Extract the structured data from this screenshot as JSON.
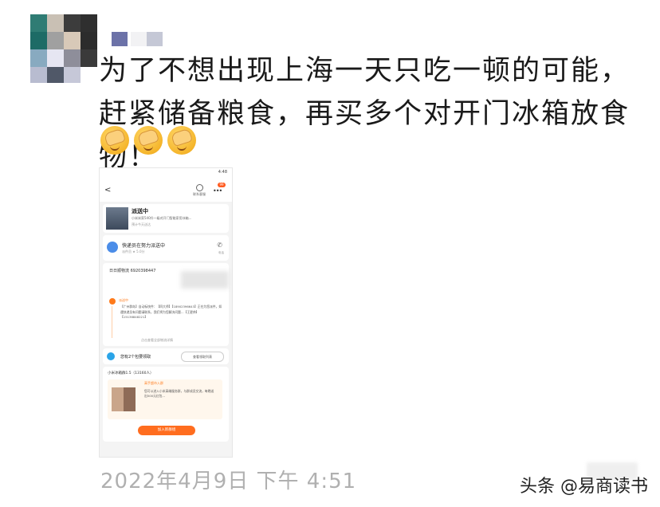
{
  "post": {
    "text": "为了不想出现上海一天只吃一顿的可能，赶紧储备粮食，再买多个对开门冰箱放食物！",
    "emojis": [
      "facepalm-icon",
      "facepalm-icon",
      "facepalm-icon"
    ],
    "timestamp": "2022年4月9日 下午 4:51"
  },
  "embedded_screenshot": {
    "status_time": "4:48",
    "nav": {
      "back": "<",
      "service_label": "联系客服",
      "badge": "99"
    },
    "order": {
      "status": "派送中",
      "desc": "小米米家540升一级对开门智能家用冰箱...",
      "sub": "预计今天送达"
    },
    "courier": {
      "title": "快递员在努力派送中",
      "sub": "派件员 ★ 5.0分",
      "phone_label": "电话"
    },
    "tracking": {
      "number": "日日顺物流 6920398447",
      "status": "派送中",
      "detail": "【广州群岛】自动标快件：【四大师】【18902396643】正在为您派件，如遇快递员有问题请联系，我们将为您解决问题...【王更帅】【15136848221】",
      "more": "点击查看全部物流详情"
    },
    "coupons": {
      "text": "您有2个包要领取",
      "button": "查看领取列表"
    },
    "group": {
      "header": "小米冰箱群1.5（13160人）",
      "title": "高手超市入群",
      "desc": "您可以进入小米高端服务群，与群成员交流，每晚送出500元红包...",
      "join": "加入新群组"
    }
  },
  "watermark": "头条 @易商读书"
}
